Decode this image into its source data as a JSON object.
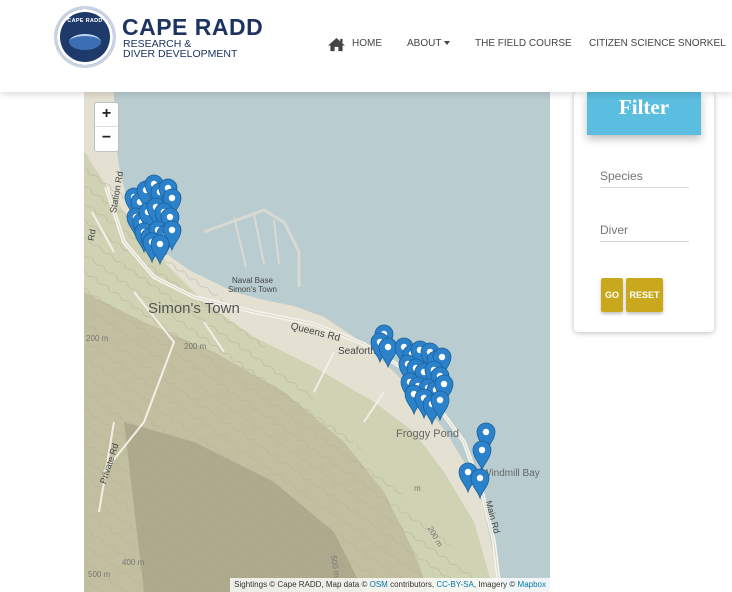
{
  "brand": {
    "logo_text": "CAPE RADD",
    "title": "CAPE RADD",
    "subtitle_line1": "RESEARCH &",
    "subtitle_line2": "DIVER DEVELOPMENT"
  },
  "nav": {
    "items": [
      {
        "label": "HOME",
        "icon": "home-icon"
      },
      {
        "label": "ABOUT",
        "icon": "caret-down-icon"
      },
      {
        "label": "THE FIELD COURSE"
      },
      {
        "label": "CITIZEN SCIENCE SNORKEL"
      }
    ]
  },
  "map": {
    "zoom_in": "+",
    "zoom_out": "−",
    "labels": {
      "station_rd": "Station Rd",
      "naval_base_1": "Naval Base",
      "naval_base_2": "Simon's Town",
      "simons_town": "Simon's Town",
      "queens_rd": "Queens Rd",
      "seaforth": "Seaforth",
      "froggy_pond": "Froggy Pond",
      "private_rd": "Private Rd",
      "elevation_200a": "200 m",
      "elevation_200b": "200 m",
      "elevation_200c": "200 m",
      "elevation_400": "400 m",
      "elevation_500a": "500 m",
      "elevation_500b": "500 m",
      "main_rd": "Main Rd",
      "windmill_bay": "Windmill Bay",
      "rd_fragment": "Rd",
      "m_fragment": "m"
    },
    "attribution": {
      "prefix": "Sightings © Cape RADD, Map data ©",
      "osm": "OSM",
      "contributors": "contributors,",
      "license": "CC-BY-SA",
      "imagery": ", Imagery ©",
      "mapbox": "Mapbox"
    },
    "water_color": "#b9cdd0",
    "marker_color": "#2b82cb"
  },
  "filter": {
    "title": "Filter",
    "species_placeholder": "Species",
    "diver_placeholder": "Diver",
    "go_label": "GO",
    "reset_label": "RESET",
    "accent_color": "#5bbde0",
    "button_color": "#c9a81e"
  }
}
